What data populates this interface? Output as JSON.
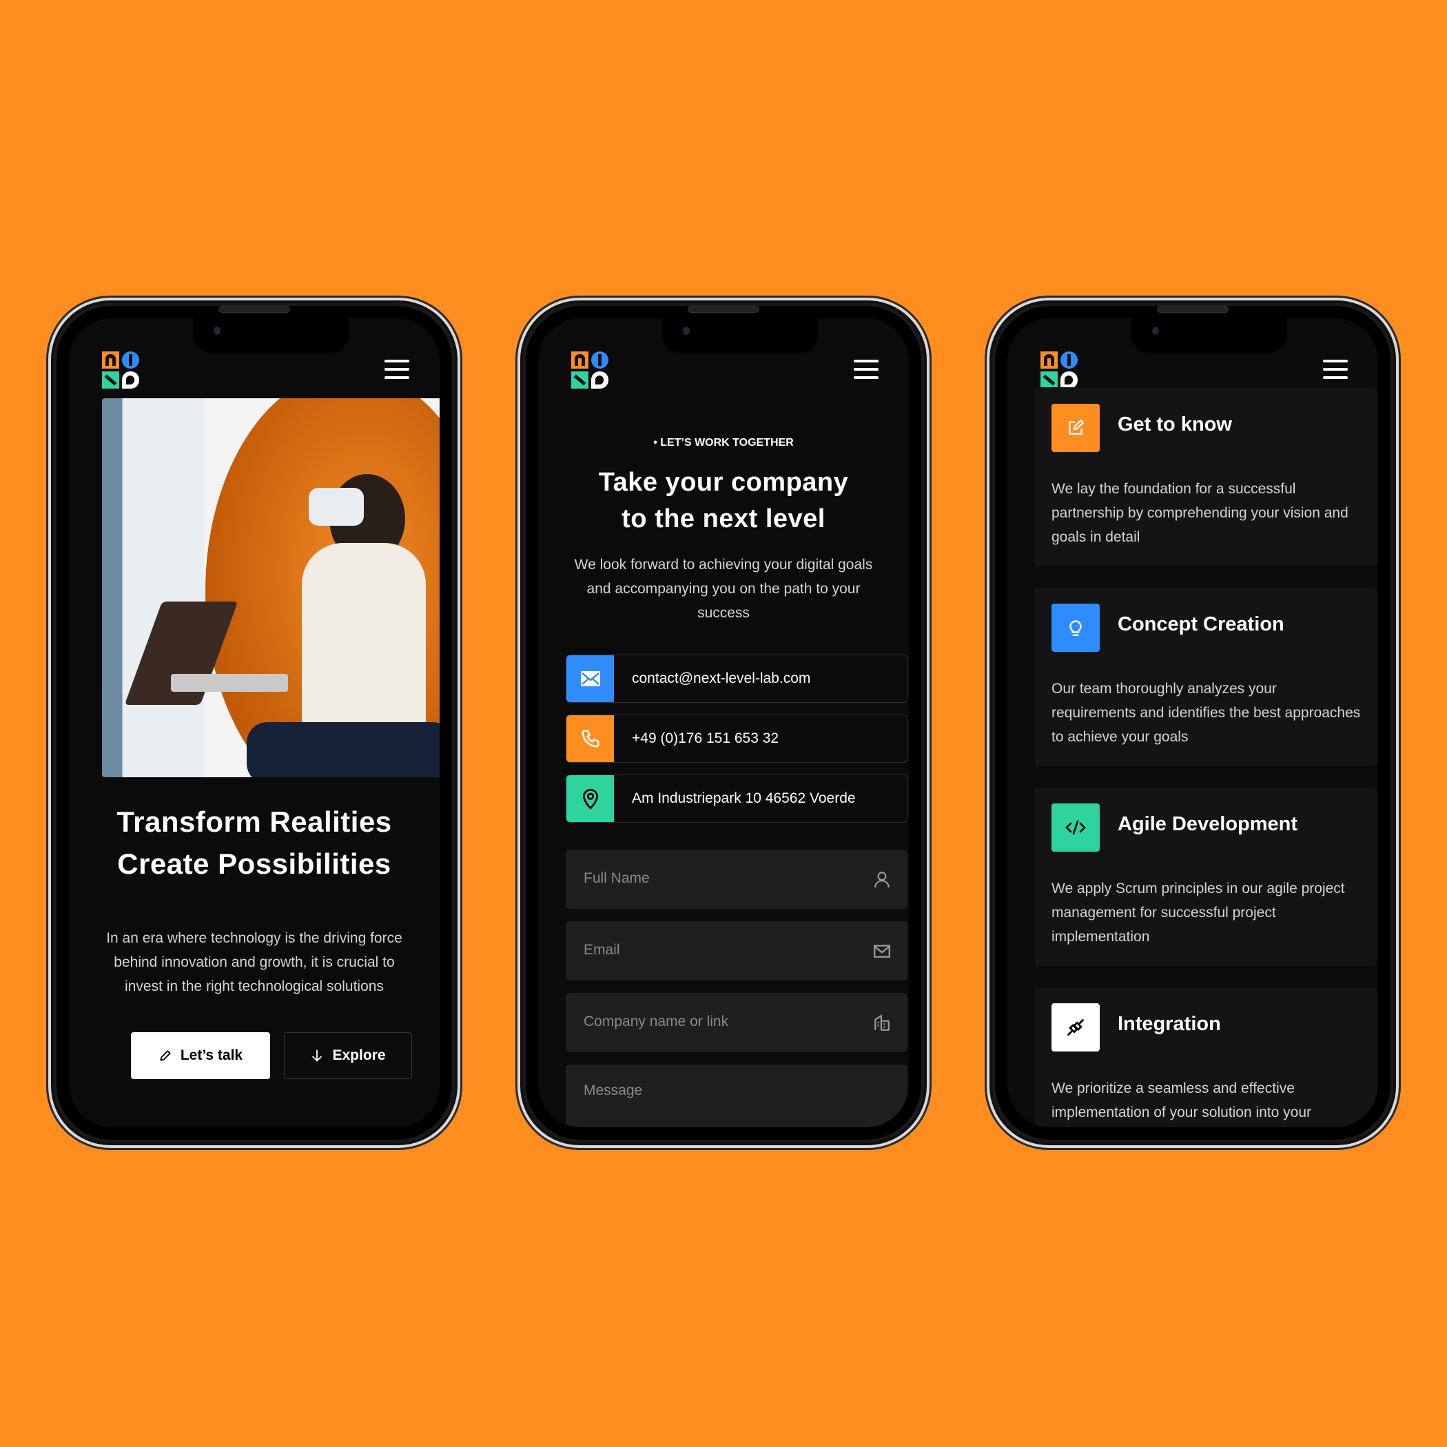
{
  "colors": {
    "background": "#FF8D1F",
    "screen": "#0B0B0B",
    "orange": "#FF8D1F",
    "blue": "#2F8CFF",
    "green": "#2ED3A0",
    "white": "#FFFFFF"
  },
  "brand": {
    "logo_name": "next-level-lab logo"
  },
  "phones": [
    {
      "hero": {
        "image_alt": "Woman wearing VR headset sitting in orange chair with laptop",
        "title_line1": "Transform Realities",
        "title_line2": "Create Possibilities",
        "description": "In an era where technology is the driving force behind innovation and growth, it is crucial to invest in the right technological solutions",
        "primary_button": "Let’s talk",
        "secondary_button": "Explore"
      }
    },
    {
      "contact": {
        "eyebrow": "LET’S WORK TOGETHER",
        "title_line1": "Take your company",
        "title_line2": "to the next level",
        "description": "We look forward to achieving your digital goals and accompanying you on the path to your success",
        "items": [
          {
            "icon": "mail-icon",
            "text": "contact@next-level-lab.com"
          },
          {
            "icon": "phone-icon",
            "text": "+49 (0)176 151 653 32"
          },
          {
            "icon": "location-pin-icon",
            "text": "Am Industriepark 10 46562 Voerde"
          }
        ],
        "form": {
          "full_name_placeholder": "Full Name",
          "email_placeholder": "Email",
          "company_placeholder": "Company name or link",
          "message_placeholder": "Message"
        }
      }
    },
    {
      "process": {
        "cards": [
          {
            "icon": "edit-icon",
            "title": "Get to know",
            "description": "We lay the foundation for a successful partnership by comprehending your vision and goals in detail"
          },
          {
            "icon": "lightbulb-icon",
            "title": "Concept Creation",
            "description": "Our team thoroughly analyzes your requirements and identifies the best approaches to achieve your goals"
          },
          {
            "icon": "code-icon",
            "title": "Agile Development",
            "description": "We apply Scrum principles in our agile project management for successful project implementation"
          },
          {
            "icon": "plug-icon",
            "title": "Integration",
            "description": "We prioritize a seamless and effective implementation of your solution into your"
          }
        ]
      }
    }
  ]
}
